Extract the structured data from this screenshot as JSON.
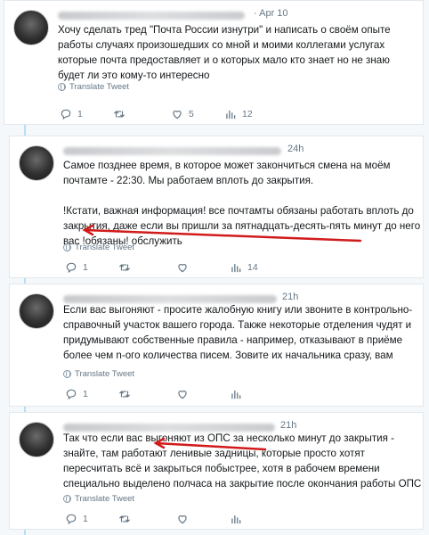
{
  "accent": "#1da1f2",
  "annotation_color": "#d11b1b",
  "translate_label": "Translate Tweet",
  "tweets": [
    {
      "time": "· Apr 10",
      "text": "Хочу сделать тред \"Почта России изнутри\" и написать о своём опыте работы случаях произошедших со мной и моими коллегами услугах которые почта предоставляет и о которых мало кто знает но не знаю будет ли это кому-то интересно",
      "replies": "1",
      "retweets": "",
      "likes": "5",
      "views": "12"
    },
    {
      "time": "24h",
      "text": "Самое позднее время, в которое может закончиться смена на моём почтамте - 22:30. Мы работаем вплоть до закрытия.\n\n!Кстати, важная информация! все почтамты обязаны работать вплоть до закрытия, даже если вы пришли за пятнадцать-десять-пять минут до него вас !обязаны! обслужить",
      "replies": "1",
      "retweets": "",
      "likes": "",
      "views": "14"
    },
    {
      "time": "21h",
      "text": "Если вас выгоняют - просите жалобную книгу или звоните в контрольно-справочный участок вашего города. Также некоторые отделения чудят и придумывают собственные правила - например, отказывают в приёме более чем n-ого количества писем. Зовите их начальника сразу, вам",
      "replies": "1",
      "retweets": "",
      "likes": "",
      "views": ""
    },
    {
      "time": "21h",
      "text": "Так что если вас выгоняют из ОПС за несколько минут до закрытия - знайте, там работают ленивые задницы, которые просто хотят пересчитать всё и закрыться побыстрее, хотя в рабочем времени специально выделено полчаса на закрытие после окончания работы ОПС",
      "replies": "1",
      "retweets": "",
      "likes": "",
      "views": ""
    }
  ]
}
